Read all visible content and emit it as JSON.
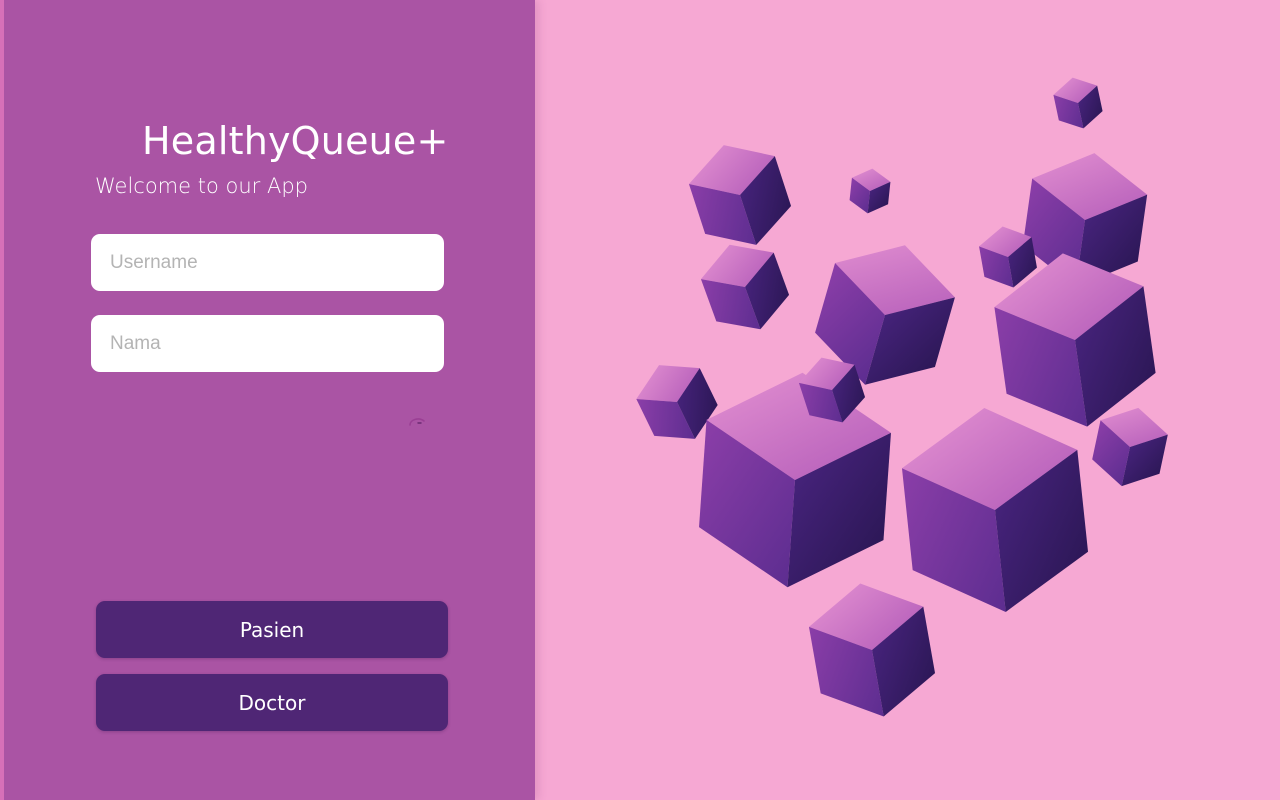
{
  "app": {
    "title": "HealthyQueue+",
    "welcome": "Welcome to our App"
  },
  "form": {
    "username_placeholder": "Username",
    "nama_placeholder": "Nama"
  },
  "buttons": {
    "pasien_label": "Pasien",
    "doctor_label": "Doctor"
  },
  "icons": {
    "loading": "loading-spinner-icon",
    "hero": "floating-cubes-illustration"
  },
  "colors": {
    "background": "#f6a8d3",
    "panel": "#aa54a4",
    "button": "#4f2675",
    "text": "#ffffff"
  }
}
